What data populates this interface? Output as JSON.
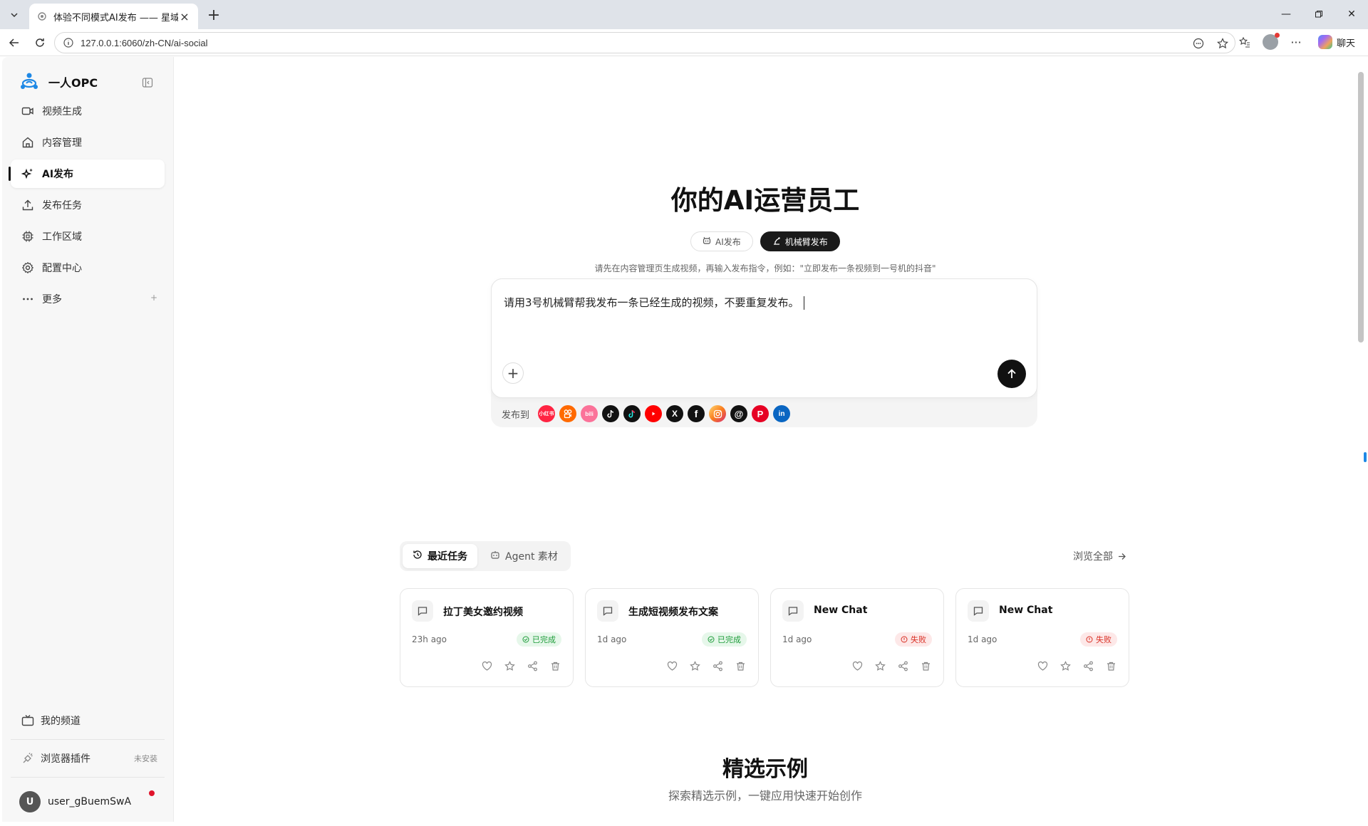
{
  "browser": {
    "tab_title": "体验不同模式AI发布 —— 星域",
    "url": "127.0.0.1:6060/zh-CN/ai-social",
    "chat_label": "聊天"
  },
  "sidebar": {
    "brand": "一人OPC",
    "items": [
      {
        "label": "视频生成",
        "icon": "video-camera-icon"
      },
      {
        "label": "内容管理",
        "icon": "home-icon"
      },
      {
        "label": "AI发布",
        "icon": "sparkle-icon"
      },
      {
        "label": "发布任务",
        "icon": "upload-icon"
      },
      {
        "label": "工作区域",
        "icon": "chip-icon"
      },
      {
        "label": "配置中心",
        "icon": "gear-icon"
      },
      {
        "label": "更多",
        "icon": "more-icon"
      }
    ],
    "my_channel": "我的频道",
    "plugin": "浏览器插件",
    "plugin_status": "未安装",
    "user_initial": "U",
    "user_name": "user_gBuemSwA"
  },
  "main": {
    "hero_title": "你的AI运营员工",
    "mode_tabs": [
      "AI发布",
      "机械臂发布"
    ],
    "hint": "请先在内容管理页生成视频，再输入发布指令，例如：\"立即发布一条视频到一号机的抖音\"",
    "composer_text": "请用3号机械臂帮我发布一条已经生成的视频，不要重复发布。",
    "publish_label": "发布到",
    "platforms": [
      {
        "name": "xiaohongshu",
        "label": "小红书",
        "color": "#ff2442"
      },
      {
        "name": "kuaishou",
        "label": "",
        "color": "#ff6a00"
      },
      {
        "name": "bilibili",
        "label": "bili",
        "color": "#fb7299"
      },
      {
        "name": "tiktok",
        "label": "",
        "color": "#111111"
      },
      {
        "name": "douyin",
        "label": "",
        "color": "#111111"
      },
      {
        "name": "youtube",
        "label": "",
        "color": "#ff0000"
      },
      {
        "name": "x",
        "label": "X",
        "color": "#111111"
      },
      {
        "name": "facebook",
        "label": "f",
        "color": "#111111"
      },
      {
        "name": "instagram",
        "label": "",
        "color": "#f0783c"
      },
      {
        "name": "threads",
        "label": "@",
        "color": "#111111"
      },
      {
        "name": "pinterest",
        "label": "P",
        "color": "#e60023"
      },
      {
        "name": "linkedin",
        "label": "in",
        "color": "#0a66c2"
      }
    ],
    "task_tabs": [
      "最近任务",
      "Agent 素材"
    ],
    "browse_all": "浏览全部",
    "cards": [
      {
        "title": "拉丁美女邀约视频",
        "time": "23h ago",
        "status": "已完成",
        "ok": true
      },
      {
        "title": "生成短视频发布文案",
        "time": "1d ago",
        "status": "已完成",
        "ok": true
      },
      {
        "title": "New Chat",
        "time": "1d ago",
        "status": "失败",
        "ok": false
      },
      {
        "title": "New Chat",
        "time": "1d ago",
        "status": "失败",
        "ok": false
      }
    ],
    "featured_title": "精选示例",
    "featured_sub": "探索精选示例，一键应用快速开始创作"
  }
}
